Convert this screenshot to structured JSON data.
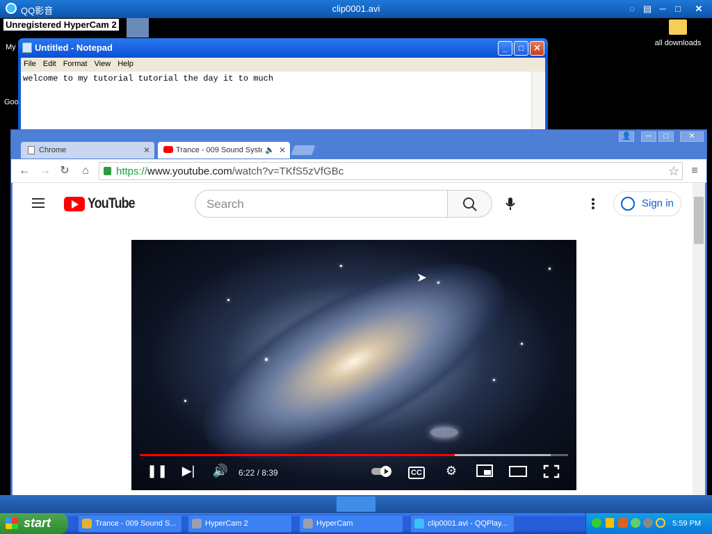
{
  "qq_player": {
    "app_title": "QQ影音",
    "file_title": "clip0001.avi"
  },
  "desktop": {
    "hypercam_banner": "Unregistered HyperCam 2",
    "icons": [
      {
        "label": "all downloads"
      }
    ],
    "partial_labels": [
      "My",
      "Goo"
    ]
  },
  "notepad": {
    "title": "Untitled - Notepad",
    "menu": [
      "File",
      "Edit",
      "Format",
      "View",
      "Help"
    ],
    "content": "welcome to my tutorial tutorial the day it to much"
  },
  "chrome": {
    "tabs": [
      {
        "label": "Chrome"
      },
      {
        "label": "Trance - 009 Sound Syste"
      }
    ],
    "url_scheme": "https://",
    "url_host": "www.youtube.com",
    "url_path": "/watch?v=TKfS5zVfGBc"
  },
  "youtube": {
    "logo_text": "YouTube",
    "search_placeholder": "Search",
    "sign_in_label": "Sign in",
    "player": {
      "time_display": "6:22 / 8:39",
      "progress_fraction": 0.736,
      "loaded_fraction": 0.96
    }
  },
  "taskbar": {
    "start_label": "start",
    "tasks": [
      {
        "label": "Trance - 009 Sound S...",
        "icon": "chrome-icon",
        "color": "#e8b030"
      },
      {
        "label": "HyperCam 2",
        "icon": "hypercam-icon",
        "color": "#9aa0b0"
      },
      {
        "label": "HyperCam",
        "icon": "hypercam-icon",
        "color": "#9aa0b0"
      },
      {
        "label": "clip0001.avi - QQPlay...",
        "icon": "qqplayer-icon",
        "color": "#3ec0ff"
      }
    ],
    "clock": "5:59 PM"
  },
  "colors": {
    "youtube_red": "#ff0000",
    "xp_blue": "#245edb",
    "start_green": "#2e8b2e"
  }
}
